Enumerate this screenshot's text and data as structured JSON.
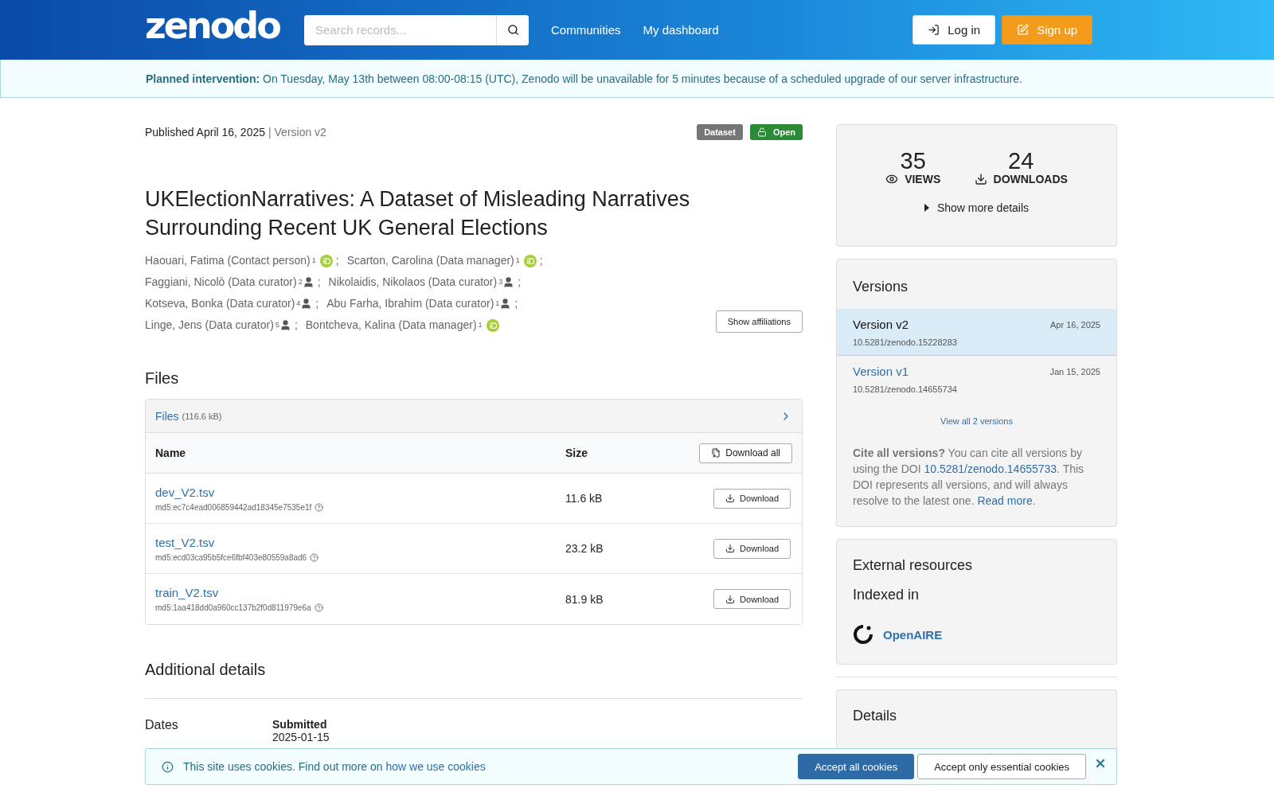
{
  "header": {
    "logo": "zenodo",
    "search": {
      "placeholder": "Search records..."
    },
    "nav": [
      "Communities",
      "My dashboard"
    ],
    "login": "Log in",
    "signup": "Sign up"
  },
  "notice": {
    "label": "Planned intervention:",
    "text": "On Tuesday, May 13th between 08:00-08:15 (UTC), Zenodo will be unavailable for 5 minutes because of a scheduled upgrade of our server infrastructure."
  },
  "record": {
    "published": "Published April 16, 2025",
    "version": "| Version v2",
    "badges": [
      {
        "kind": "type",
        "label": "Dataset"
      },
      {
        "kind": "access",
        "label": "Open"
      }
    ],
    "title": "UKElectionNarratives: A Dataset of Misleading Narratives Surrounding Recent UK General Elections",
    "authors": [
      {
        "name": "Haouari, Fatima (Contact person)",
        "affiliation": "1",
        "kind": "orcid",
        "separator": ";"
      },
      {
        "name": "Scarton, Carolina (Data manager)",
        "affiliation": "1",
        "kind": "orcid",
        "separator": ";"
      },
      {
        "name": "Faggiani, Nicolò (Data curator)",
        "affiliation": "2",
        "kind": "person",
        "separator": ";"
      },
      {
        "name": "Nikolaidis, Nikolaos (Data curator)",
        "affiliation": "3",
        "kind": "person",
        "separator": ";"
      },
      {
        "name": "Kotseva, Bonka (Data curator)",
        "affiliation": "4",
        "kind": "person",
        "separator": ";"
      },
      {
        "name": "Abu Farha, Ibrahim (Data curator)",
        "affiliation": "1",
        "kind": "person",
        "separator": ";"
      },
      {
        "name": "Linge, Jens (Data curator)",
        "affiliation": "5",
        "kind": "person",
        "separator": ";"
      },
      {
        "name": "Bontcheva, Kalina (Data manager)",
        "affiliation": "1",
        "kind": "orcid"
      }
    ],
    "show_affiliations": "Show affiliations"
  },
  "files": {
    "heading": "Files",
    "panel_title": "Files",
    "total": "(116.6 kB)",
    "columns": [
      "Name",
      "Size"
    ],
    "download_all": "Download all",
    "rows": [
      {
        "name": "dev_V2.tsv",
        "md5": "md5:ec7c4ead006859442ad18345e7535e1f",
        "size": "11.6 kB",
        "action": "Download"
      },
      {
        "name": "test_V2.tsv",
        "md5": "md5:ecd03ca95b5fce6fbf403e80559a8ad6",
        "size": "23.2 kB",
        "action": "Download"
      },
      {
        "name": "train_V2.tsv",
        "md5": "md5:1aa418dd0a960cc137b2f0d811979e6a",
        "size": "81.9 kB",
        "action": "Download"
      }
    ]
  },
  "additional": {
    "heading": "Additional details",
    "dates_label": "Dates",
    "date_type": "Submitted",
    "date_value": "2025-01-15"
  },
  "stats": {
    "views": "35",
    "views_label": "VIEWS",
    "downloads": "24",
    "downloads_label": "DOWNLOADS",
    "more": "Show more details"
  },
  "versions": {
    "heading": "Versions",
    "items": [
      {
        "label": "Version v2",
        "date": "Apr 16, 2025",
        "doi": "10.5281/zenodo.15228283",
        "selected": true
      },
      {
        "label": "Version v1",
        "date": "Jan 15, 2025",
        "doi": "10.5281/zenodo.14655734",
        "selected": false
      }
    ],
    "view_all": "View all 2 versions",
    "cite_bold": "Cite all versions?",
    "cite_text": "You can cite all versions by using the DOI",
    "cite_doi": "10.5281/zenodo.14655733",
    "cite_rest": ". This DOI represents all versions, and will always resolve to the latest one.",
    "read_more": "Read more",
    "read_more_end": "."
  },
  "external": {
    "heading": "External resources",
    "subheading": "Indexed in",
    "items": [
      "OpenAIRE"
    ]
  },
  "details": {
    "heading": "Details"
  },
  "cookies": {
    "text": "This site uses cookies. Find out more on",
    "link": "how we use cookies",
    "accept_all": "Accept all cookies",
    "accept_essential": "Accept only essential cookies"
  }
}
